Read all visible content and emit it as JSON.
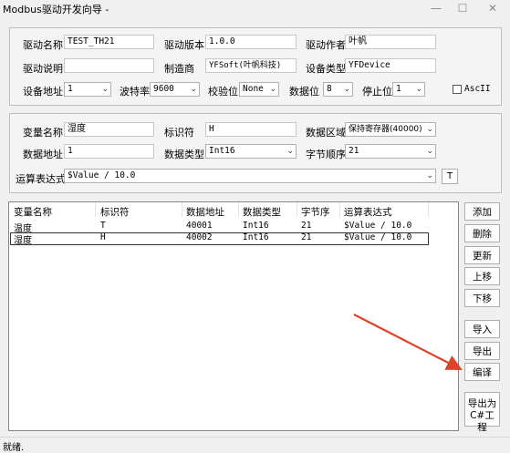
{
  "window": {
    "title": "Modbus驱动开发向导 -",
    "min_icon": "minimize-icon",
    "max_icon": "maximize-icon",
    "close_icon": "close-icon",
    "min_glyph": "—",
    "max_glyph": "☐",
    "close_glyph": "✕"
  },
  "driver": {
    "name_label": "驱动名称",
    "name_value": "TEST_TH21",
    "version_label": "驱动版本",
    "version_value": "1.0.0",
    "author_label": "驱动作者",
    "author_value": "叶帆",
    "desc_label": "驱动说明",
    "desc_value": "",
    "maker_label": "制造商",
    "maker_value": "YFSoft(叶帆科技)",
    "devtype_label": "设备类型",
    "devtype_value": "YFDevice",
    "addr_label": "设备地址",
    "addr_value": "1",
    "baud_label": "波特率",
    "baud_value": "9600",
    "parity_label": "校验位",
    "parity_value": "None",
    "databits_label": "数据位",
    "databits_value": "8",
    "stopbits_label": "停止位",
    "stopbits_value": "1",
    "ascii_label": "AscII",
    "ascii_checked": false
  },
  "variable": {
    "name_label": "变量名称",
    "name_value": "湿度",
    "id_label": "标识符",
    "id_value": "H",
    "area_label": "数据区域",
    "area_value": "保持寄存器(40000)",
    "addr_label": "数据地址",
    "addr_value": "1",
    "dtype_label": "数据类型",
    "dtype_value": "Int16",
    "order_label": "字节顺序",
    "order_value": "21",
    "expr_label": "运算表达式",
    "expr_value": "$Value / 10.0",
    "expr_button": "T"
  },
  "table": {
    "columns": [
      "变量名称",
      "标识符",
      "数据地址",
      "数据类型",
      "字节序",
      "运算表达式"
    ],
    "rows": [
      [
        "温度",
        "T",
        "40001",
        "Int16",
        "21",
        "$Value / 10.0"
      ],
      [
        "湿度",
        "H",
        "40002",
        "Int16",
        "21",
        "$Value / 10.0"
      ]
    ],
    "selected_row": 1
  },
  "buttons": {
    "add": "添加",
    "delete": "删除",
    "update": "更新",
    "up": "上移",
    "down": "下移",
    "import": "导入",
    "export": "导出",
    "compile": "编译",
    "export_cs_line1": "导出为",
    "export_cs_line2": "C#工程"
  },
  "status": {
    "text": "就绪."
  },
  "annotation": {
    "color": "#e0432b"
  }
}
